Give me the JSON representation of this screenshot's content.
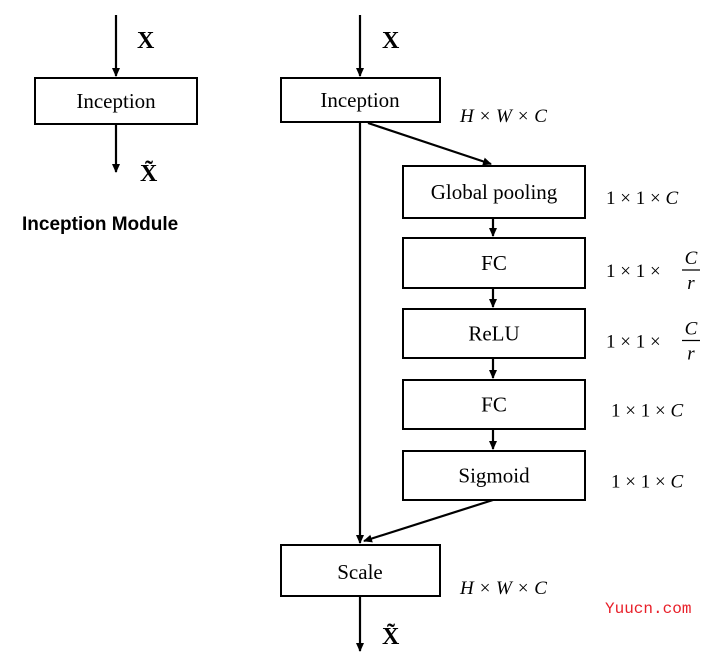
{
  "left": {
    "input_label": "X",
    "block": "Inception",
    "output_label": "X̃",
    "caption": "Inception Module"
  },
  "right": {
    "input_label": "X",
    "inception": "Inception",
    "inception_dim": "H × W × C",
    "blocks": [
      {
        "label": "Global pooling",
        "dim_prefix": "1 × 1 × ",
        "dim_num": "C",
        "dim_den": ""
      },
      {
        "label": "FC",
        "dim_prefix": "1 × 1 × ",
        "dim_num": "C",
        "dim_den": "r"
      },
      {
        "label": "ReLU",
        "dim_prefix": "1 × 1 × ",
        "dim_num": "C",
        "dim_den": "r"
      },
      {
        "label": "FC",
        "dim_prefix": "1 × 1 × ",
        "dim_num": "C",
        "dim_den": ""
      },
      {
        "label": "Sigmoid",
        "dim_prefix": "1 × 1 × ",
        "dim_num": "C",
        "dim_den": ""
      }
    ],
    "scale": "Scale",
    "scale_dim": "H × W × C",
    "output_label": "X̃"
  },
  "watermark": "Yuucn.com"
}
